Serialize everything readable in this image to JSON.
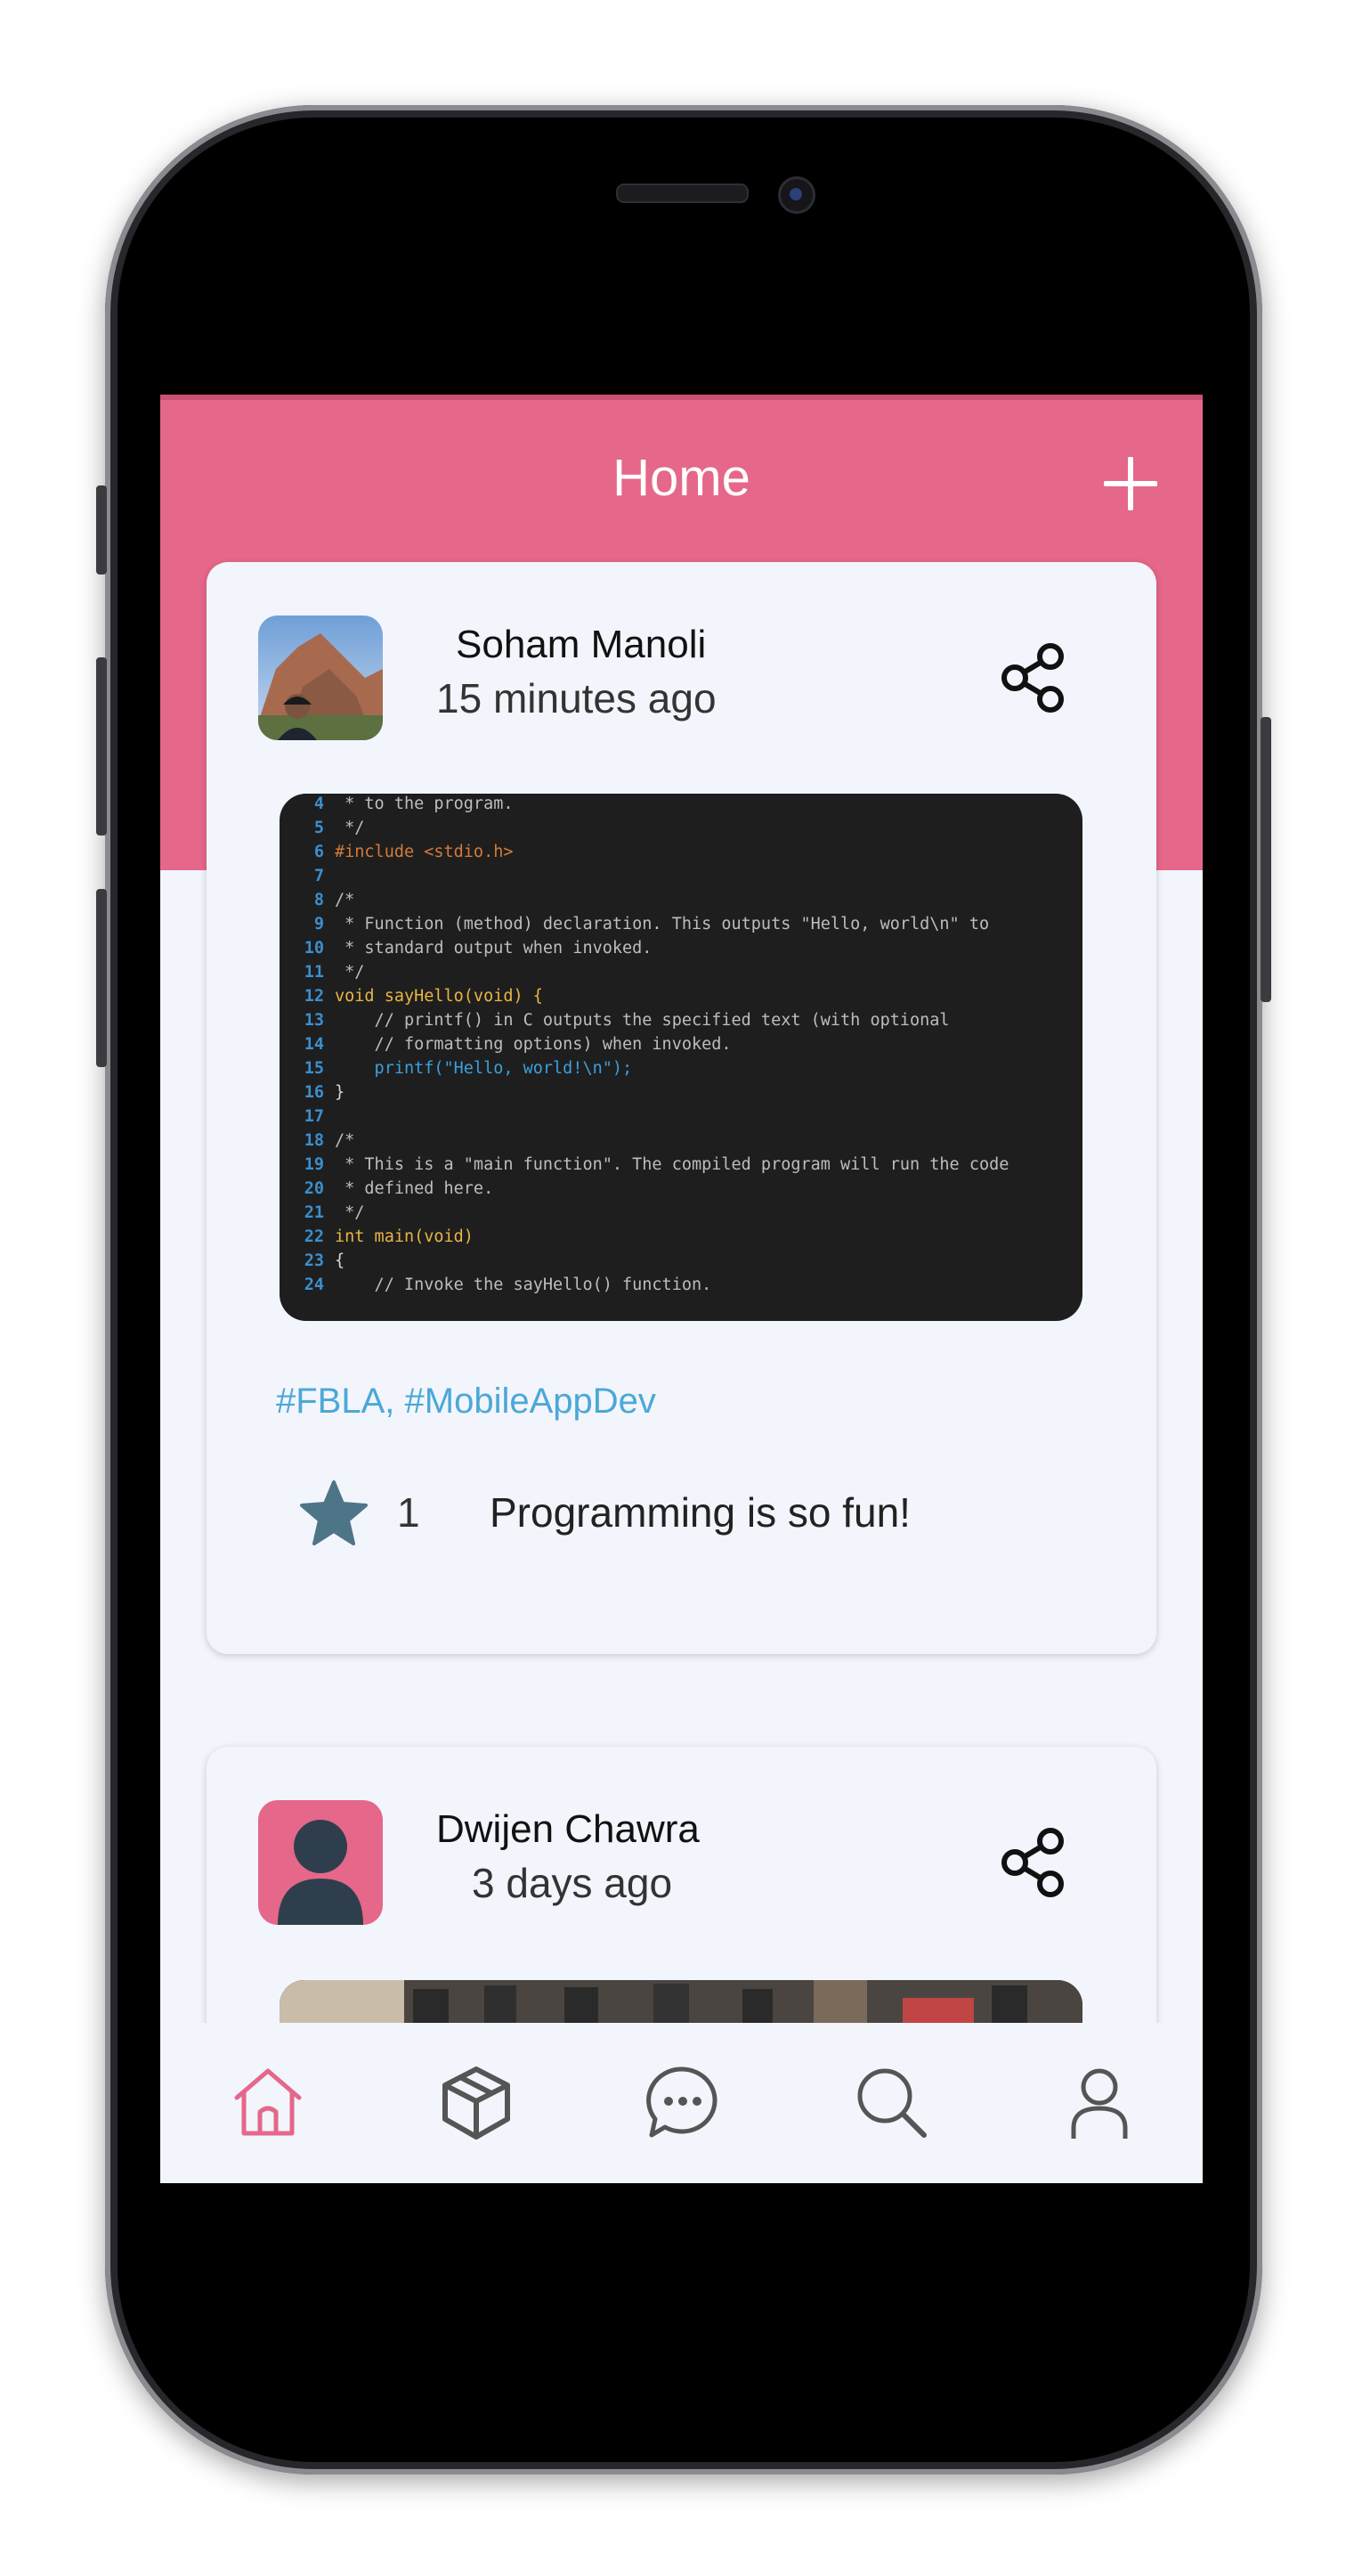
{
  "header": {
    "title": "Home",
    "add_icon": "plus-icon",
    "color": "#e5678a"
  },
  "posts": [
    {
      "author": "Soham Manoli",
      "time": "15 minutes ago",
      "avatar": "photo-avatar",
      "share_icon": "share-icon",
      "code_lines": [
        {
          "num": "4",
          "text": " * to the program."
        },
        {
          "num": "5",
          "text": " */"
        },
        {
          "num": "6",
          "text": "#include <stdio.h>"
        },
        {
          "num": "7",
          "text": ""
        },
        {
          "num": "8",
          "text": "/*"
        },
        {
          "num": "9",
          "text": " * Function (method) declaration. This outputs \"Hello, world\\n\" to"
        },
        {
          "num": "10",
          "text": " * standard output when invoked."
        },
        {
          "num": "11",
          "text": " */"
        },
        {
          "num": "12",
          "text": "void sayHello(void) {"
        },
        {
          "num": "13",
          "text": "    // printf() in C outputs the specified text (with optional"
        },
        {
          "num": "14",
          "text": "    // formatting options) when invoked."
        },
        {
          "num": "15",
          "text": "    printf(\"Hello, world!\\n\");"
        },
        {
          "num": "16",
          "text": "}"
        },
        {
          "num": "17",
          "text": ""
        },
        {
          "num": "18",
          "text": "/*"
        },
        {
          "num": "19",
          "text": " * This is a \"main function\". The compiled program will run the code"
        },
        {
          "num": "20",
          "text": " * defined here."
        },
        {
          "num": "21",
          "text": " */"
        },
        {
          "num": "22",
          "text": "int main(void)"
        },
        {
          "num": "23",
          "text": "{"
        },
        {
          "num": "24",
          "text": "    // Invoke the sayHello() function."
        }
      ],
      "tags": "#FBLA, #MobileAppDev",
      "likes": "1",
      "caption": "Programming is so fun!"
    },
    {
      "author": "Dwijen Chawra",
      "time": "3 days ago",
      "avatar": "person-placeholder-avatar",
      "share_icon": "share-icon"
    }
  ],
  "nav": [
    {
      "icon": "home-icon",
      "active": true
    },
    {
      "icon": "cube-icon",
      "active": false
    },
    {
      "icon": "chat-icon",
      "active": false
    },
    {
      "icon": "search-icon",
      "active": false
    },
    {
      "icon": "profile-icon",
      "active": false
    }
  ]
}
